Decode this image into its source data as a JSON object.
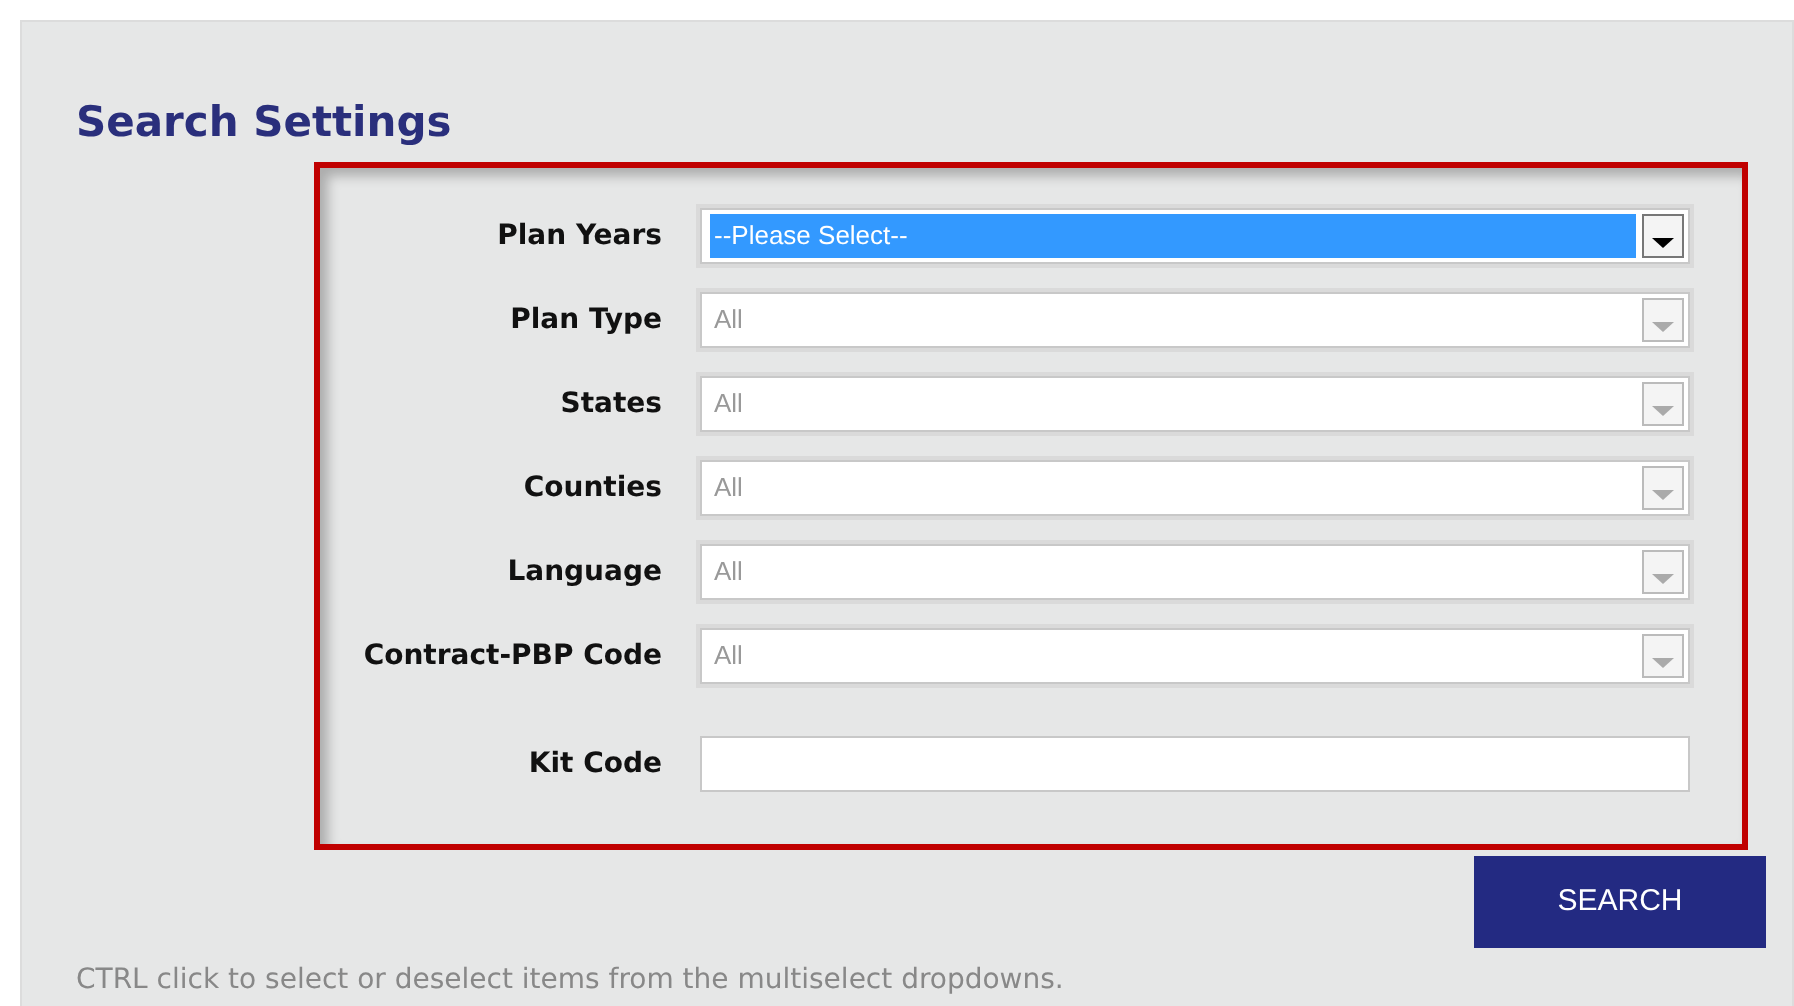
{
  "title": "Search Settings",
  "fields": [
    {
      "label": "Plan Years",
      "kind": "select",
      "value": "--Please Select--",
      "focused": true
    },
    {
      "label": "Plan Type",
      "kind": "select",
      "value": "All",
      "focused": false
    },
    {
      "label": "States",
      "kind": "select",
      "value": "All",
      "focused": false
    },
    {
      "label": "Counties",
      "kind": "select",
      "value": "All",
      "focused": false
    },
    {
      "label": "Language",
      "kind": "select",
      "value": "All",
      "focused": false
    },
    {
      "label": "Contract-PBP Code",
      "kind": "select",
      "value": "All",
      "focused": false
    },
    {
      "label": "Kit Code",
      "kind": "text"
    }
  ],
  "search_button": "SEARCH",
  "hint": "CTRL click to select or deselect items from the multiselect dropdowns."
}
